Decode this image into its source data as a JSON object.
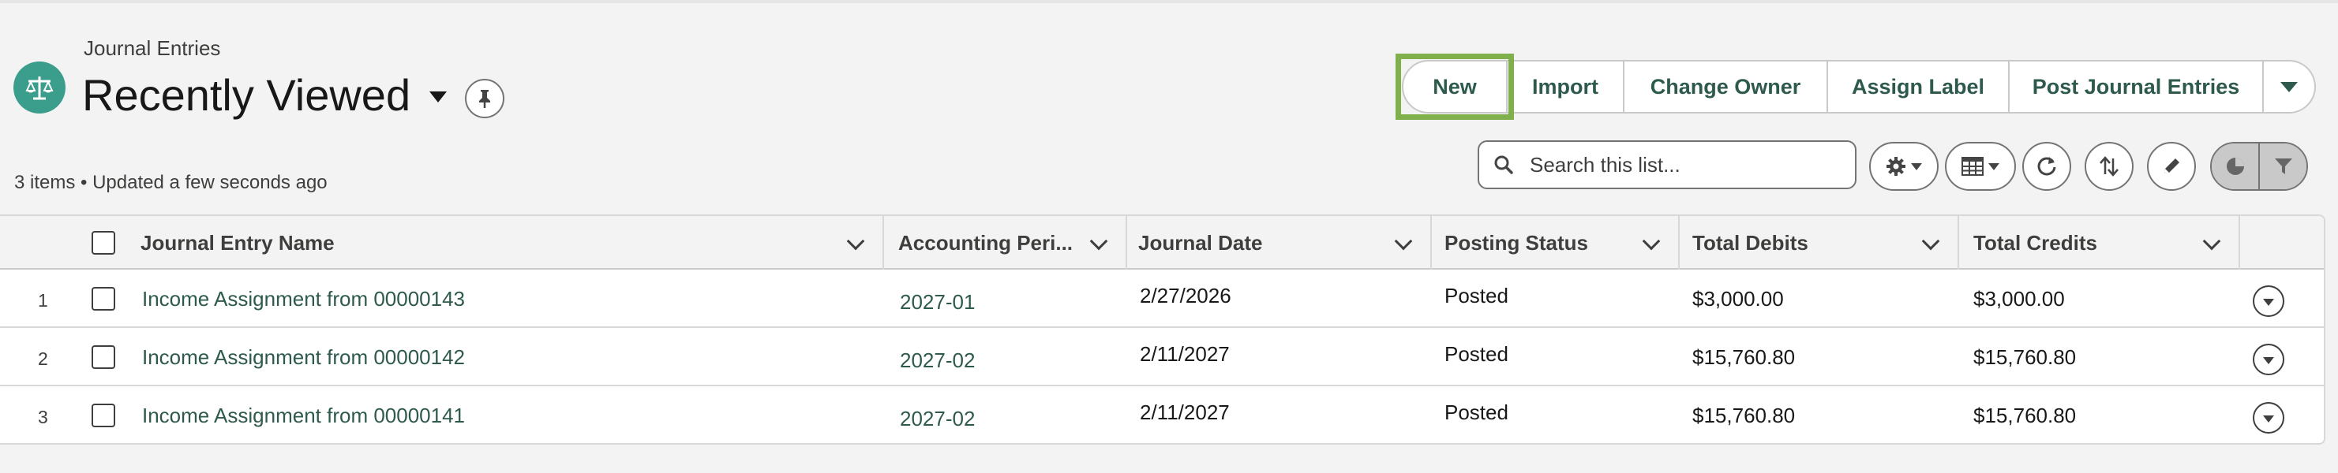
{
  "header": {
    "object_label": "Journal Entries",
    "list_view_name": "Recently Viewed",
    "status": "3 items • Updated a few seconds ago",
    "icon": "scales-icon",
    "icon_color": "#3b9e8c"
  },
  "actions": {
    "new": "New",
    "import": "Import",
    "change_owner": "Change Owner",
    "assign_label": "Assign Label",
    "post_journal_entries": "Post Journal Entries"
  },
  "search": {
    "placeholder": "Search this list..."
  },
  "toolbar_icons": [
    "settings-icon",
    "table-columns-icon",
    "refresh-icon",
    "sort-icon",
    "edit-icon",
    "chart-icon",
    "filter-icon"
  ],
  "table": {
    "columns": [
      "Journal Entry Name",
      "Accounting Peri...",
      "Journal Date",
      "Posting Status",
      "Total Debits",
      "Total Credits"
    ],
    "rows": [
      {
        "num": "1",
        "name": "Income Assignment from 00000143",
        "period": "2027-01",
        "date": "2/27/2026",
        "status": "Posted",
        "debits": "$3,000.00",
        "credits": "$3,000.00"
      },
      {
        "num": "2",
        "name": "Income Assignment from 00000142",
        "period": "2027-02",
        "date": "2/11/2027",
        "status": "Posted",
        "debits": "$15,760.80",
        "credits": "$15,760.80"
      },
      {
        "num": "3",
        "name": "Income Assignment from 00000141",
        "period": "2027-02",
        "date": "2/11/2027",
        "status": "Posted",
        "debits": "$15,760.80",
        "credits": "$15,760.80"
      }
    ]
  },
  "colors": {
    "accent": "#2e5a4e",
    "highlight": "#7fb04c"
  }
}
